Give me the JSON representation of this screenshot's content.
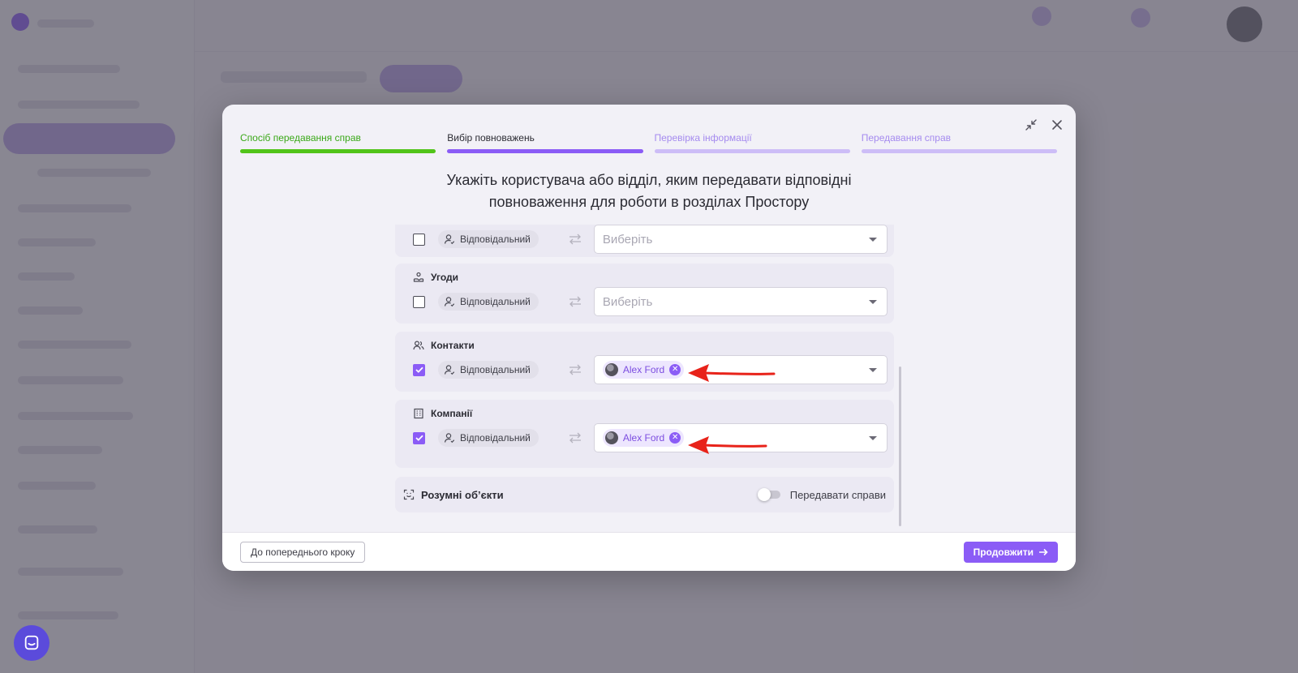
{
  "steps": [
    {
      "label": "Спосіб передавання справ",
      "state": "done"
    },
    {
      "label": "Вибір повноважень",
      "state": "active"
    },
    {
      "label": "Перевірка інформації",
      "state": "todo"
    },
    {
      "label": "Передавання справ",
      "state": "todo"
    }
  ],
  "heading": {
    "line1": "Укажіть користувача або відділ, яким передавати відповідні",
    "line2": "повноваження для роботи в розділах Простору"
  },
  "sections": {
    "top": {
      "role": "Відповідальний",
      "checked": false,
      "placeholder": "Виберіть"
    },
    "deals": {
      "title": "Угоди",
      "icon": "handshake-icon",
      "role": "Відповідальний",
      "checked": false,
      "placeholder": "Виберіть"
    },
    "contacts": {
      "title": "Контакти",
      "icon": "users-icon",
      "role": "Відповідальний",
      "checked": true,
      "assignee": "Alex Ford"
    },
    "companies": {
      "title": "Компанії",
      "icon": "building-icon",
      "role": "Відповідальний",
      "checked": true,
      "assignee": "Alex Ford"
    }
  },
  "smart_objects": {
    "title": "Розумні об’єкти",
    "toggle_label": "Передавати справи",
    "toggle_on": false
  },
  "footer": {
    "back_label": "До попереднього кроку",
    "next_label": "Продовжити"
  },
  "colors": {
    "accent": "#8b5cf6",
    "done": "#52c41a",
    "annotation_arrow": "#e8231a"
  }
}
